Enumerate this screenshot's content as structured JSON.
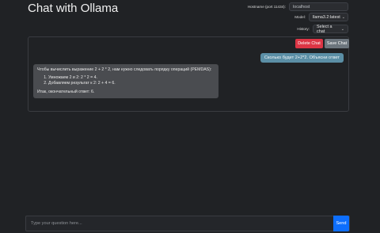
{
  "header": {
    "title": "Chat with Ollama"
  },
  "controls": {
    "hostname": {
      "label": "Hostname (port 11434):",
      "placeholder": "localhost",
      "value": ""
    },
    "model": {
      "label": "Model:",
      "selected": "llama3.2:latest"
    },
    "history": {
      "label": "History:",
      "selected": "Select a chat"
    }
  },
  "chat": {
    "delete_label": "Delete Chat",
    "save_label": "Save Chat",
    "messages": [
      {
        "role": "user",
        "text": "Сколько будет 2+2*2. Объясни ответ"
      },
      {
        "role": "assistant",
        "intro": "Чтобы вычислить выражение 2 + 2 * 2, нам нужно следовать порядку операций (PEMDAS):",
        "steps": [
          "Умножаем 2 и 2: 2 * 2 = 4.",
          "Добавляем результат к 2: 2 + 4 = 6."
        ],
        "conclusion": "Итак, окончательный ответ: 6."
      }
    ]
  },
  "input": {
    "placeholder": "Type your question here...",
    "value": "",
    "send_label": "Send"
  },
  "colors": {
    "background": "#202225",
    "delete": "#dc3545",
    "save": "#6c757d",
    "send": "#0d6efd",
    "user_bubble": "#5b8fa6",
    "assistant_bubble": "#4a4c50"
  }
}
